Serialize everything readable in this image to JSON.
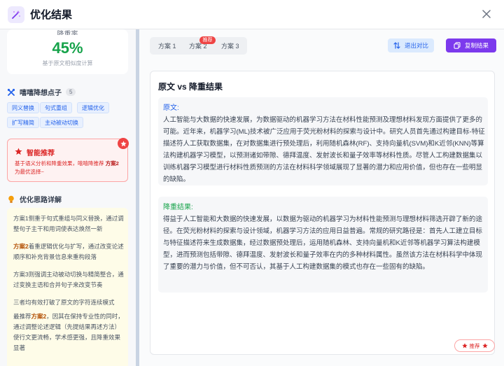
{
  "header": {
    "title": "优化结果"
  },
  "sidebar": {
    "rate": {
      "label": "降重率",
      "value": "45%",
      "note": "基于原文相似度计算"
    },
    "points": {
      "title": "嘻嘻降想点子",
      "count": "5",
      "tags": [
        "同义替换",
        "句式重组",
        "逻辑优化",
        "扩写精简",
        "主动被动切换"
      ]
    },
    "recommend": {
      "title": "智能推荐",
      "desc_before": "基于语义分析和降重效果，嘻嘻降推荐 ",
      "desc_plan": "方案2",
      "desc_after": " 为最优选择~"
    },
    "reasoning": {
      "title": "优化思路详解",
      "p1": "方案1侧重于句式重组与同义替换，通过调整句子主干和用词使表达焕然一新",
      "p2_plan": "方案2",
      "p2_rest": "着重逻辑优化与扩写，通过改变论述顺序和补充背景信息来重构段落",
      "p3": "方案3则强调主动被动切换与精简整合，通过变换主语和合并句子来改变节奏",
      "p4": "三者均有效打破了原文的字符连续模式",
      "p5_a": "最推荐",
      "p5_plan": "方案2",
      "p5_rest": "，因其在保持专业性的同时，通过调整论述逻辑（先提结果再述方法）使行文更流畅，学术感更强，且降重效果显著"
    }
  },
  "main": {
    "tabs": [
      "方案 1",
      "方案 2",
      "方案 3"
    ],
    "hot_badge": "推荐",
    "exit_button": "退出对比",
    "copy_button": "复制结果",
    "panel_title": "原文 vs 降重结果",
    "original": {
      "label": "原文:",
      "text": "人工智能与大数据的快速发展，为数据驱动的机器学习方法在材料性能预测及理想材料发现方面提供了更多的可能。近年来，机器学习(ML)技术被广泛应用于荧光粉材料的探索与设计中。研究人员首先通过构建目标-特征描述符人工获取数据集，在对数据集进行预处理后，利用随机森林(RF)、支持向量机(SVM)和K近邻(KNN)等算法构建机器学习模型，以预测诸如带隙、德拜温度、发射波长和量子效率等材料性质。尽管人工构建数据集以训练机器学习模型进行材料性质预测的方法在材料科学领域展现了显著的潜力和应用价值，但也存在一些明显的缺陷。"
    },
    "result": {
      "label": "降重结果:",
      "text": "得益于人工智能和大数据的快速发展，以数据为驱动的机器学习为材料性能预测与理想材料筛选开辟了新的途径。在荧光粉材料的探索与设计领域，机器学习方法的应用日益普遍。常规的研究路径是：首先人工建立目标与特征描述符来生成数据集，经过数据预处理后，运用随机森林、支持向量机和K近邻等机器学习算法构建模型，进而预测包括带隙、德拜温度、发射波长和量子效率在内的多种材料属性。虽然该方法在材料科学中体现了重要的潜力与价值，但不可否认，其基于人工构建数据集的模式也存在一些固有的缺陷。"
    },
    "float_badge": "推荐"
  }
}
